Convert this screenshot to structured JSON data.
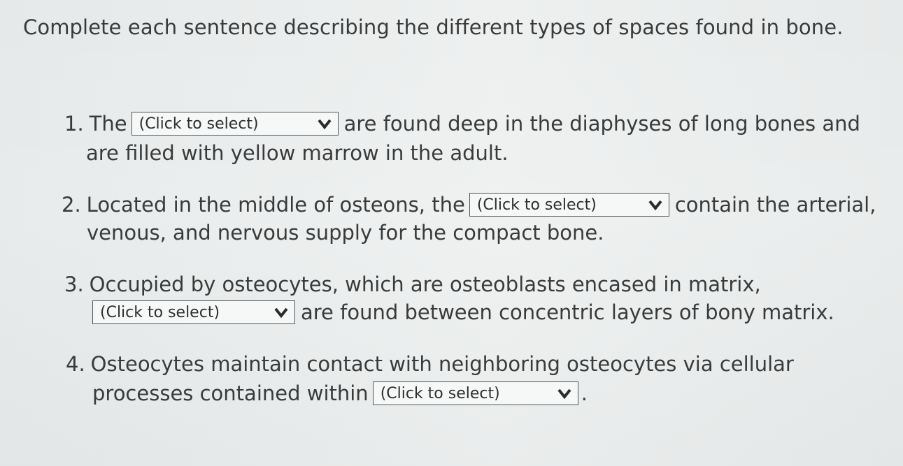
{
  "instruction": "Complete each sentence describing the different types of spaces found in bone.",
  "questions": [
    {
      "number": "1.",
      "before": "The",
      "dropdown": "(Click to select)",
      "after": "are found deep in the diaphyses of long bones and",
      "line2": "are filled with yellow marrow in the adult."
    },
    {
      "number": "2.",
      "before": "Located in the middle of osteons, the",
      "dropdown": "(Click to select)",
      "after": "contain the arterial,",
      "line2": "venous, and nervous supply for the compact bone."
    },
    {
      "number": "3.",
      "line1": "Occupied by osteocytes, which are osteoblasts encased in matrix,",
      "dropdown": "(Click to select)",
      "after": "are found between concentric layers of bony matrix."
    },
    {
      "number": "4.",
      "line1": "Osteocytes maintain contact with neighboring osteocytes via cellular",
      "before": "processes contained within",
      "dropdown": "(Click to select)",
      "after": "."
    }
  ],
  "icons": {
    "dropdown_chevron": "chevron-down-icon"
  }
}
